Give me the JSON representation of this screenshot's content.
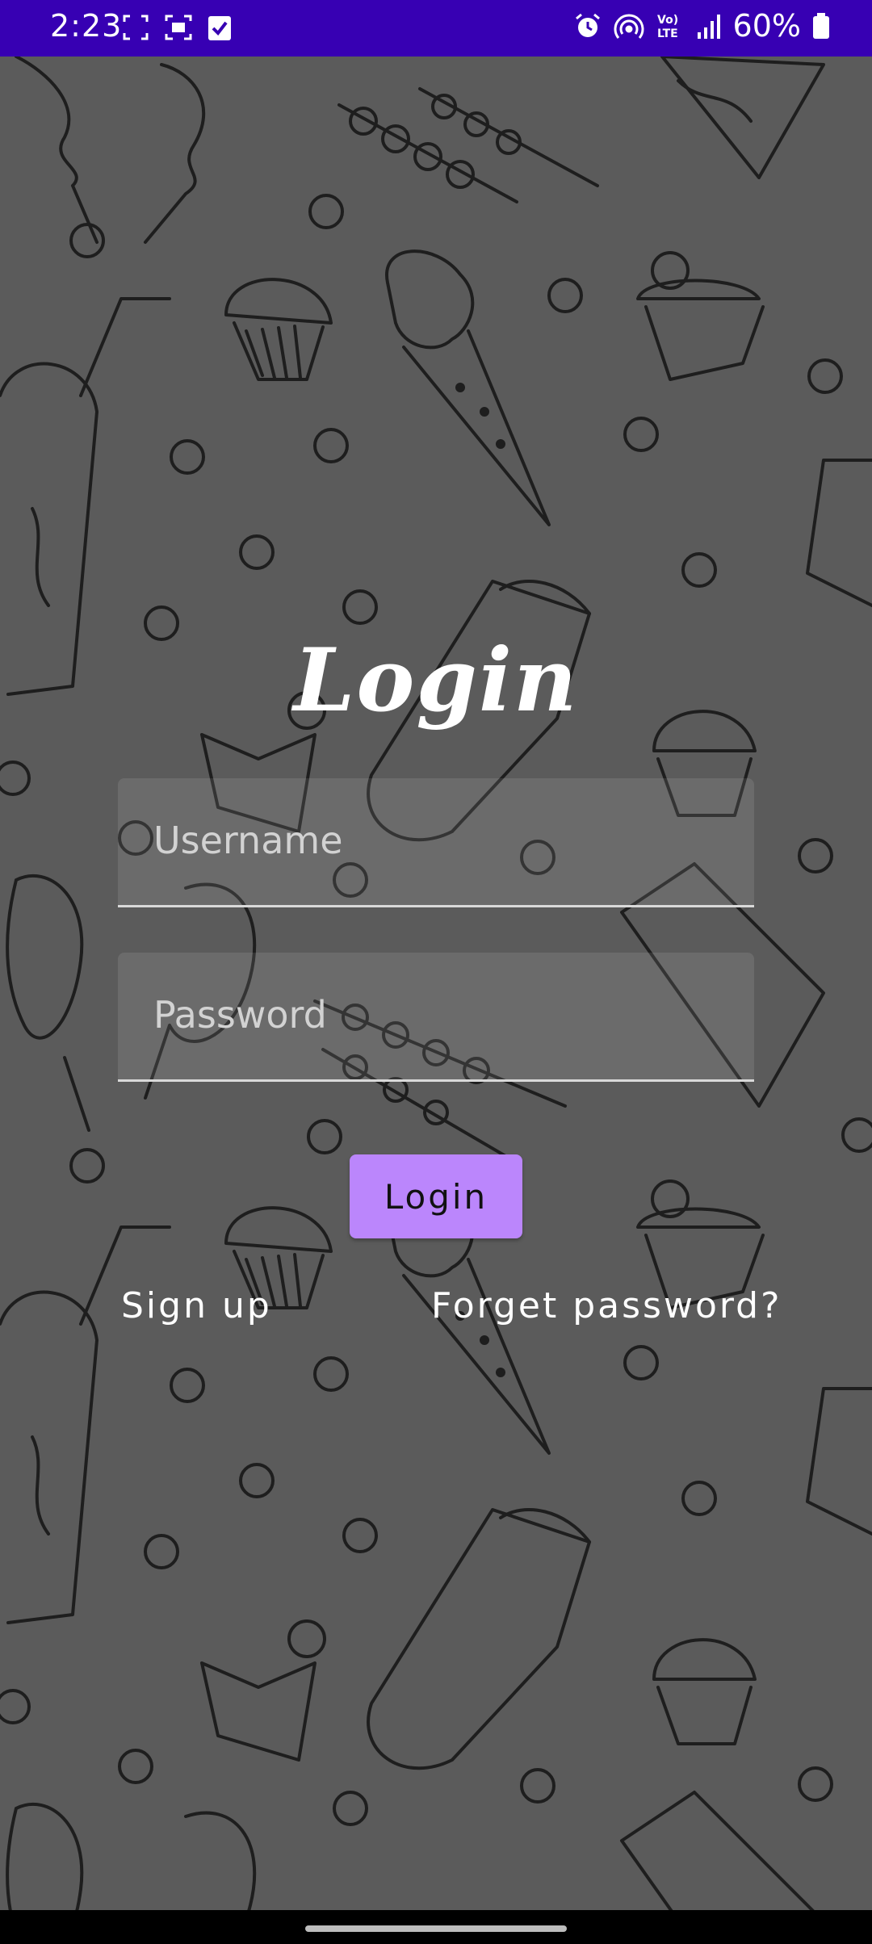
{
  "status_bar": {
    "time": "2:23",
    "battery": "60%",
    "background": "#3700b3"
  },
  "login_screen": {
    "title": "Login",
    "username_placeholder": "Username",
    "password_placeholder": "Password",
    "login_button": "Login",
    "sign_up": "Sign up",
    "forget_password": "Forget password?",
    "button_color": "#bb86fc"
  },
  "icons": {
    "status_left": [
      "screenshot-icon",
      "screen-record-icon",
      "task-check-icon"
    ],
    "status_right": [
      "alarm-icon",
      "hotspot-icon",
      "volte-icon",
      "signal-icon",
      "battery-icon"
    ]
  }
}
